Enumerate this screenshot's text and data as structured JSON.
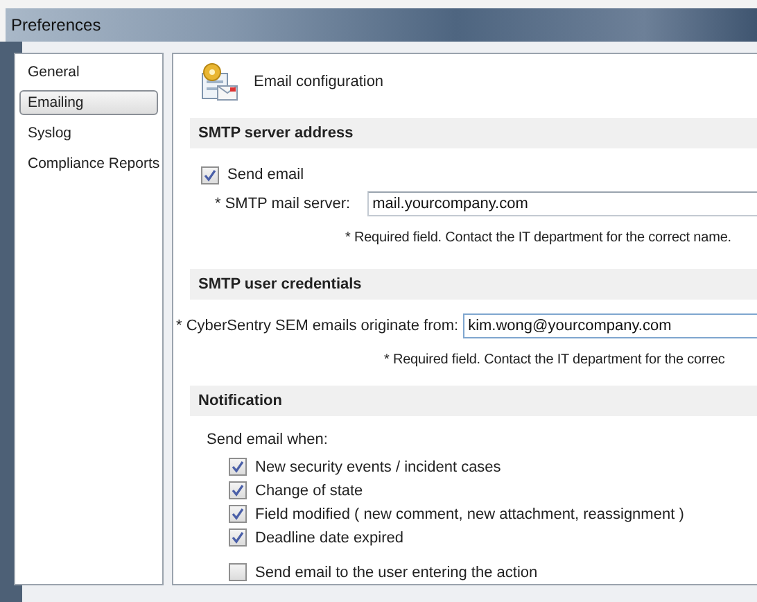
{
  "window": {
    "title": "Preferences"
  },
  "sidebar": {
    "items": [
      {
        "label": "General",
        "selected": false
      },
      {
        "label": "Emailing",
        "selected": true
      },
      {
        "label": "Syslog",
        "selected": false
      },
      {
        "label": "Compliance Reports",
        "selected": false
      }
    ]
  },
  "header": {
    "title": "Email configuration"
  },
  "smtp_server": {
    "title": "SMTP server address",
    "send_email": {
      "label": "Send email",
      "checked": true
    },
    "server_label": "* SMTP mail server:",
    "server_value": "mail.yourcompany.com",
    "note": "* Required field. Contact the IT department for the correct name."
  },
  "smtp_credentials": {
    "title": "SMTP user credentials",
    "from_label": "* CyberSentry SEM emails originate from:",
    "from_value": "kim.wong@yourcompany.com",
    "note": "* Required field. Contact the IT department for the correc"
  },
  "notification": {
    "title": "Notification",
    "intro": "Send email when:",
    "options": [
      {
        "label": "New security events / incident cases",
        "checked": true
      },
      {
        "label": "Change of state",
        "checked": true
      },
      {
        "label": "Field modified ( new comment, new attachment, reassignment )",
        "checked": true
      },
      {
        "label": "Deadline date expired",
        "checked": true
      }
    ],
    "extra": {
      "label": "Send email to the user entering the action",
      "checked": false
    }
  }
}
